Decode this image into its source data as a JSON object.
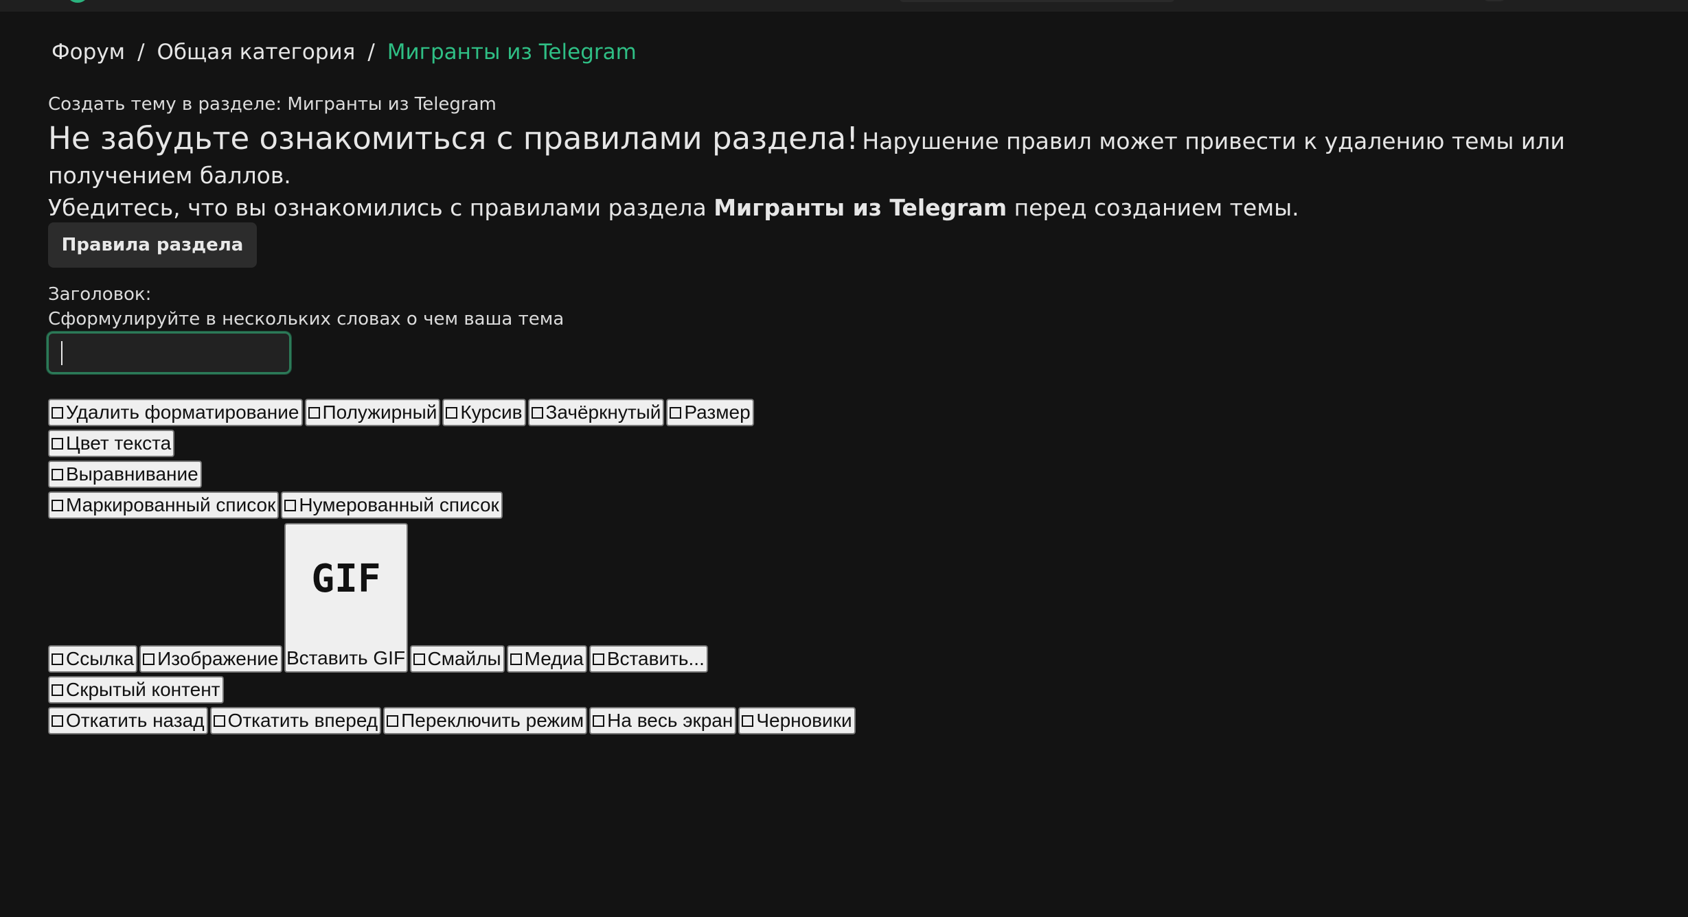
{
  "breadcrumb": {
    "items": [
      "Форум",
      "Общая категория",
      "Мигранты из Telegram"
    ],
    "separator": "/"
  },
  "subtitle": "Создать тему в разделе: Мигранты из Telegram",
  "notice": {
    "headline": "Не забудьте ознакомиться с правилами раздела!",
    "warning": "Нарушение правил может привести к удалению темы или получением баллов.",
    "confirm_before": "Убедитесь, что вы ознакомились с правилами раздела",
    "section_name": "Мигранты из Telegram",
    "confirm_after": "перед созданием темы."
  },
  "rules_button": "Правила раздела",
  "form": {
    "title_label": "Заголовок:",
    "title_hint": "Сформулируйте в нескольких словах о чем ваша тема",
    "title_value": ""
  },
  "toolbar": {
    "row1": [
      "Удалить форматирование",
      "Полужирный",
      "Курсив",
      "Зачёркнутый",
      "Размер"
    ],
    "row2": [
      "Цвет текста"
    ],
    "row3": [
      "Выравнивание"
    ],
    "row4": [
      "Маркированный список",
      "Нумерованный список"
    ],
    "row5_before": [
      "Ссылка",
      "Изображение"
    ],
    "gif": {
      "art_text": "GIF",
      "label": "Вставить GIF"
    },
    "row5_after": [
      "Смайлы",
      "Медиа",
      "Вставить..."
    ],
    "row6": [
      "Скрытый контент"
    ],
    "row7": [
      "Откатить назад",
      "Откатить вперед",
      "Переключить режим",
      "На весь экран",
      "Черновики"
    ]
  },
  "colors": {
    "background": "#131313",
    "accent": "#2fbf85",
    "input_border": "#2c7a58",
    "button_bg": "#2c2c2c"
  }
}
